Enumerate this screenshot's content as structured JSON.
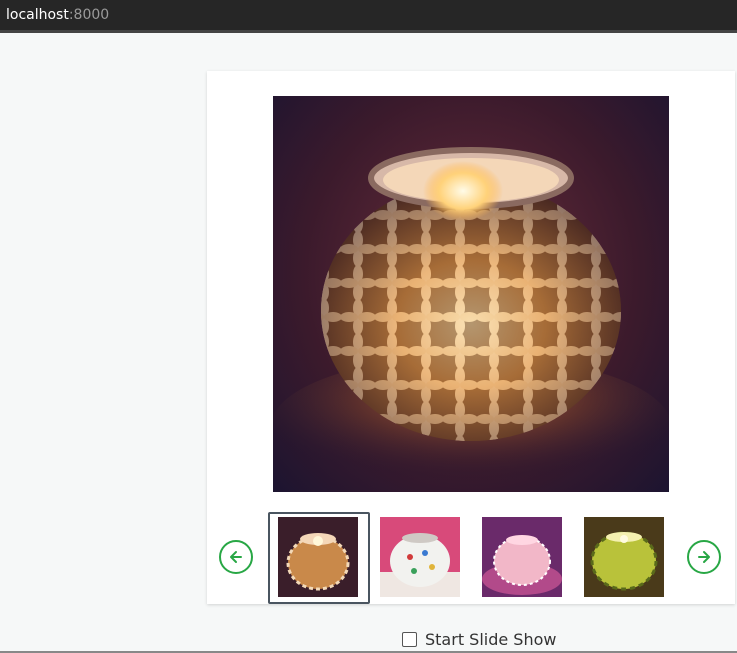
{
  "browser": {
    "host": "localhost",
    "port": ":8000"
  },
  "gallery": {
    "main_image_icon": "mosaic-candle-holder-photo",
    "thumbnails": [
      {
        "icon": "amber-flower-candle-holder-thumbnail",
        "selected": true
      },
      {
        "icon": "white-mosaic-candle-holder-thumbnail",
        "selected": false
      },
      {
        "icon": "pink-mosaic-candle-holder-thumbnail",
        "selected": false
      },
      {
        "icon": "green-mosaic-candle-holder-thumbnail",
        "selected": false
      }
    ],
    "prev_icon": "arrow-left-icon",
    "next_icon": "arrow-right-icon",
    "accent_color": "#28a745"
  },
  "slideshow": {
    "label": "Start Slide Show",
    "checked": false
  }
}
